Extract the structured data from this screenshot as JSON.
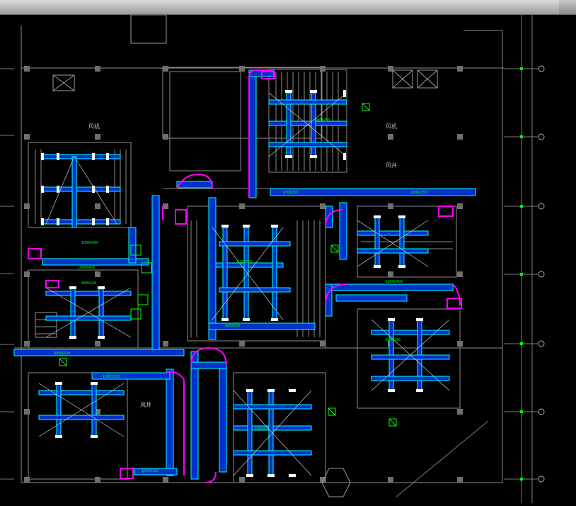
{
  "window": {
    "title": ""
  },
  "colors": {
    "background": "#000000",
    "wall": "#8c8c8c",
    "duct_outline": "#00ffff",
    "duct_fill": "#0040ff",
    "diffuser": "#ffffff",
    "label": "#00ff00",
    "fitting": "#ff00ff",
    "grid": "#00ff00"
  },
  "drawing": {
    "duct_labels": [
      {
        "text": "1000X400"
      },
      {
        "text": "1000X400"
      },
      {
        "text": "630X250"
      },
      {
        "text": "1000X250"
      },
      {
        "text": "400X250"
      },
      {
        "text": "1250X400"
      },
      {
        "text": "1000X320"
      },
      {
        "text": "1000X320"
      },
      {
        "text": "630X320"
      },
      {
        "text": "800X250"
      },
      {
        "text": "1000X320"
      },
      {
        "text": "630X250"
      },
      {
        "text": "630X250"
      },
      {
        "text": "800X320"
      }
    ],
    "room_marks": [
      {
        "text": "风机"
      },
      {
        "text": "风机"
      },
      {
        "text": "风井"
      },
      {
        "text": "风井"
      }
    ]
  }
}
